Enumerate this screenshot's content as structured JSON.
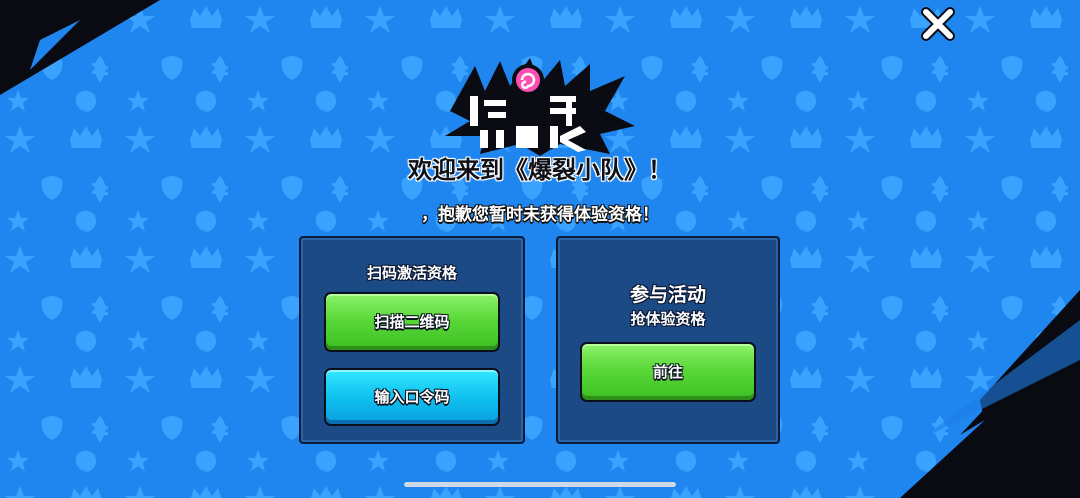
{
  "colors": {
    "background_blue": "#1f86ef",
    "pattern_blue": "#3aa2ff",
    "panel": "#1b4a85",
    "green_button": "#5ad83a",
    "cyan_button": "#10c2f0"
  },
  "header": {
    "logo_text": "爆裂小队",
    "welcome": "欢迎来到《爆裂小队》！",
    "sorry": "，抱歉您暂时未获得体验资格！"
  },
  "close": {
    "icon": "close-icon"
  },
  "left_panel": {
    "title": "扫码激活资格",
    "scan_button": "扫描二维码",
    "code_button": "输入口令码"
  },
  "right_panel": {
    "title": "参与活动",
    "subtitle": "抢体验资格",
    "go_button": "前往"
  }
}
